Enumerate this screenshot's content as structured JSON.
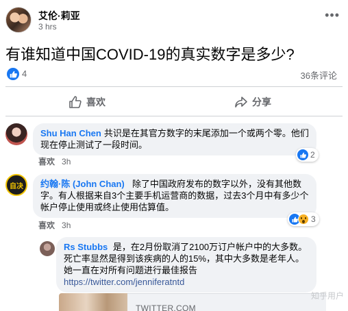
{
  "post": {
    "author": "艾伦·莉亚",
    "time": "3 hrs",
    "more": "•••",
    "text": "有谁知道中国COVID-19的真实数字是多少?",
    "reaction_count": "4",
    "comment_count": "36条评论"
  },
  "actions": {
    "like_label": "喜欢",
    "share_label": "分享"
  },
  "comments": [
    {
      "name": "Shu Han Chen",
      "text_line1": "共识是在其官方数字的末尾添加一个或两个零。他们",
      "text_line2": "现在停止测试了一段时间。",
      "like_label": "喜欢",
      "time": "3h",
      "reactions": "2"
    },
    {
      "name": "约翰·陈 (John Chan)",
      "text_line1": "除了中国政府发布的数字以外，没有其他数",
      "text_line2": "字。有人根据来自3个主要手机运营商的数据，过去3个月中有多少个",
      "text_line3": "帐户停止使用或终止使用估算值。",
      "like_label": "喜欢",
      "time": "3h",
      "reactions": "3",
      "avatar_text": "自决"
    },
    {
      "name": "Rs Stubbs",
      "text_line1": "是，在2月份取消了2100万订户帐户中的大多数。",
      "text_line2": "死亡率显然是得到该疾病的人的15%，其中大多数是老年人。",
      "text_line3": "她一直在对所有问题进行最佳报告",
      "link": "https://twitter.com/jenniferatntd"
    }
  ],
  "preview": {
    "domain": "TWITTER.COM"
  },
  "watermark": "知乎用户",
  "colors": {
    "accent": "#1877f2",
    "bubble": "#f0f2f5",
    "meta": "#65676b"
  }
}
